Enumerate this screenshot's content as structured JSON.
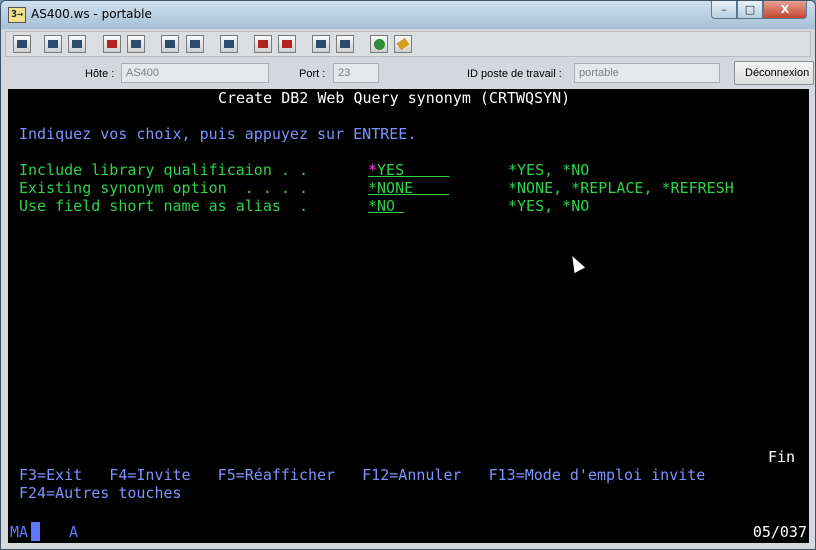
{
  "window": {
    "title": "AS400.ws - portable",
    "app_icon": "3→",
    "buttons": {
      "minimize": "–",
      "maximize": "□",
      "close": "X"
    }
  },
  "toolbar": {
    "icons": [
      "print-icon",
      "copy-icon",
      "paste-icon",
      "send-icon",
      "receive-icon",
      "display-icon",
      "display2-icon",
      "keyboard-icon",
      "macro-play-icon",
      "macro-record-icon",
      "macro-stop-icon",
      "macro-pause-icon",
      "globe-icon",
      "help-icon"
    ]
  },
  "connection": {
    "host_label": "Hôte :",
    "host_value": "AS400",
    "port_label": "Port :",
    "port_value": "23",
    "wsid_label": "ID poste de travail :",
    "wsid_value": "portable",
    "disconnect_label": "Déconnexion"
  },
  "terminal": {
    "title": "Create DB2 Web Query synonym (CRTWQSYN)",
    "instruction": "Indiquez vos choix, puis appuyez sur ENTREE.",
    "params": [
      {
        "label": "Include library qualificaion . .",
        "value_prefix": "*",
        "value_rest": "YES     ",
        "choices": "*YES, *NO"
      },
      {
        "label": "Existing synonym option  . . . .",
        "value_prefix": "",
        "value_rest": "*NONE    ",
        "choices": "*NONE, *REPLACE, *REFRESH"
      },
      {
        "label": "Use field short name as alias  .",
        "value_prefix": "",
        "value_rest": "*NO ",
        "choices": "*YES, *NO"
      }
    ],
    "more": "Fin",
    "fkeys_line1": "F3=Exit   F4=Invite   F5=Réafficher   F12=Annuler   F13=Mode d'emploi invite",
    "fkeys_line2": "F24=Autres touches"
  },
  "status": {
    "mode": "MA",
    "indicator": "A",
    "cursor_pos": "05/037"
  },
  "colors": {
    "screen_bg": "#000000",
    "title_fg": "#ffffff",
    "text_blue": "#7c93ff",
    "field_green": "#2fd24a",
    "cursor_pink": "#ff3cf0"
  }
}
